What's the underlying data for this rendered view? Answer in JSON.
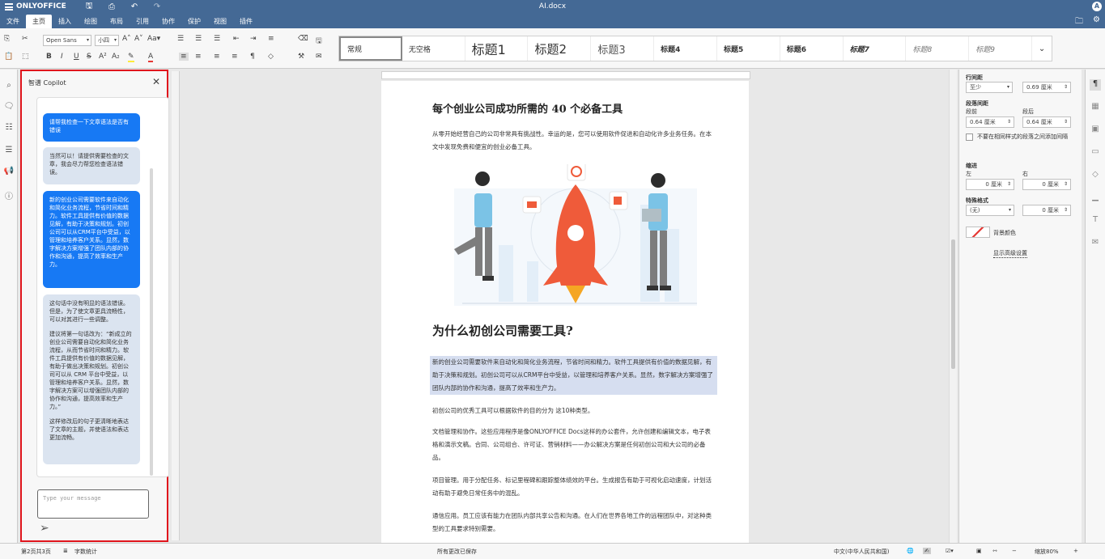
{
  "header": {
    "app_name": "ONLYOFFICE",
    "doc_title": "AI.docx",
    "user_initial": "A"
  },
  "tabs": [
    {
      "label": "文件",
      "active": false
    },
    {
      "label": "主页",
      "active": true
    },
    {
      "label": "插入",
      "active": false
    },
    {
      "label": "绘图",
      "active": false
    },
    {
      "label": "布局",
      "active": false
    },
    {
      "label": "引用",
      "active": false
    },
    {
      "label": "协作",
      "active": false
    },
    {
      "label": "保护",
      "active": false
    },
    {
      "label": "视图",
      "active": false
    },
    {
      "label": "插件",
      "active": false
    }
  ],
  "toolbar": {
    "font_name": "Open Sans",
    "font_size": "小四",
    "styles": [
      "常规",
      "无空格",
      "标题1",
      "标题2",
      "标题3",
      "标题4",
      "标题5",
      "标题6",
      "标题7",
      "标题8",
      "标题9"
    ]
  },
  "copilot": {
    "title": "智谱 Copilot",
    "messages": [
      {
        "role": "user",
        "paragraphs": [
          "请帮我检查一下文章语法是否有错误"
        ]
      },
      {
        "role": "ai",
        "paragraphs": [
          "当然可以！请提供需要检查的文章，我会尽力帮您检查语法错误。"
        ]
      },
      {
        "role": "user",
        "paragraphs": [
          "新的创业公司需要软件来自动化和简化业务流程，节省时间和精力。软件工具提供有价值的数据见解，有助于决策和规划。初创公司可以从CRM平台中受益，以管理和培养客户关系。显然，数字解决方案增强了团队内部的协作和沟通，提高了效率和生产力。"
        ]
      },
      {
        "role": "ai",
        "paragraphs": [
          "这句话中没有明显的语法错误。但是，为了使文章更具流畅性，可以对其进行一些调整。",
          "建议将第一句话改为：“新成立的创业公司需要自动化和简化业务流程，从而节省时间和精力。软件工具提供有价值的数据见解，有助于做出决策和规划。初创公司可以从 CRM 平台中受益，以管理和培养客户关系。显然，数字解决方案可以增强团队内部的协作和沟通，提高效率和生产力。”",
          "这样修改后的句子更清晰地表达了文章的主题，并使语法和表达更加流畅。"
        ]
      }
    ],
    "input_placeholder": "Type your message"
  },
  "document": {
    "title": "每个创业公司成功所需的 40 个必备工具",
    "intro": "从零开始经营自己的公司非常具有挑战性。幸运的是，您可以使用软件促进和自动化许多业务任务。在本文中发现免费和便宜的创业必备工具。",
    "heading2": "为什么初创公司需要工具?",
    "highlighted_para": "新的创业公司需要软件来自动化和简化业务流程，节省时间和精力。软件工具提供有价值的数据见解，有助于决策和规划。初创公司可以从CRM平台中受益，以管理和培养客户关系。显然，数字解决方案增强了团队内部的协作和沟通，提高了效率和生产力。",
    "para2": "初创公司的优秀工具可以根据软件的目的分为 这10种类型。",
    "para3": "文档管理和协作。这些应用程序是像ONLYOFFICE Docs这样的办公套件，允许创建和编辑文本，电子表格和演示文稿。合同、公司组合、许可证、营销材料——办公解决方案是任何初创公司和大公司的必备品。",
    "para4": "项目管理。用于分配任务、标记里程碑和跟踪整体绩效的平台。生成报告有助于可视化启动速度，计划活动有助于避免日常任务中的混乱。",
    "para5": "通信应用。员工应该有能力在团队内部共享公告和沟通。在人们在世界各地工作的远程团队中，对这种类型的工具要求特别需要。"
  },
  "settings": {
    "line_spacing_label": "行间距",
    "line_spacing_mode": "至少",
    "line_spacing_value": "0.69 厘米",
    "para_spacing_label": "段落间距",
    "before_label": "段前",
    "after_label": "段后",
    "before_value": "0.64 厘米",
    "after_value": "0.64 厘米",
    "no_space_label": "不要在相同样式的段落之间添加间隔",
    "indent_label": "缩进",
    "left_label": "左",
    "right_label": "右",
    "left_value": "0 厘米",
    "right_value": "0 厘米",
    "special_label": "特殊格式",
    "special_value": "(无)",
    "special_amount": "0 厘米",
    "bg_color_label": "背景颜色",
    "advanced_link": "显示高级设置"
  },
  "status": {
    "page_info": "第2页共3页",
    "word_count": "字数统计",
    "save_status": "所有更改已保存",
    "language": "中文(中华人民共和国)",
    "zoom": "缩放80%"
  },
  "colors": {
    "header_bg": "#446995",
    "user_bubble": "#1779f4",
    "ai_bubble": "#dbe4f0",
    "highlight_border": "#e0151d",
    "rocket": "#ef5b3a"
  }
}
